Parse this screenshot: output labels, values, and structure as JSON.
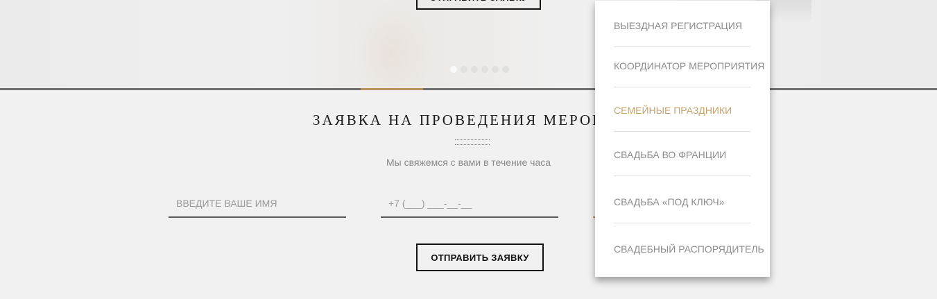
{
  "hero": {
    "button_label": "ОТПРАВИТЬ ЗАЯВКУ",
    "slider_dots": 6,
    "active_dot": 0
  },
  "form": {
    "title": "ЗАЯВКА НА ПРОВЕДЕНИЯ МЕРОПРИЯ",
    "subtitle": "Мы свяжемся с вами в течение часа",
    "name_placeholder": "ВВЕДИТЕ ВАШЕ ИМЯ",
    "phone_placeholder": "+7 (___) ___-__-__",
    "submit_label": "ОТПРАВИТЬ ЗАЯВКУ"
  },
  "dropdown": {
    "items": [
      {
        "label": "ВЫЕЗДНАЯ РЕГИСТРАЦИЯ"
      },
      {
        "label": "КООРДИНАТОР МЕРОПРИЯТИЯ"
      },
      {
        "label": "СЕМЕЙНЫЕ ПРАЗДНИКИ"
      },
      {
        "label": "СВАДЬБА ВО ФРАНЦИИ"
      },
      {
        "label": "СВАДЬБА «ПОД КЛЮЧ»"
      },
      {
        "label": "СВАДЕБНЫЙ РАСПОРЯДИТЕЛЬ"
      }
    ],
    "active_index": 2
  },
  "colors": {
    "accent_gold": "#c4a46f",
    "text_muted": "#8c8c8c",
    "background": "#f1f1f1"
  }
}
